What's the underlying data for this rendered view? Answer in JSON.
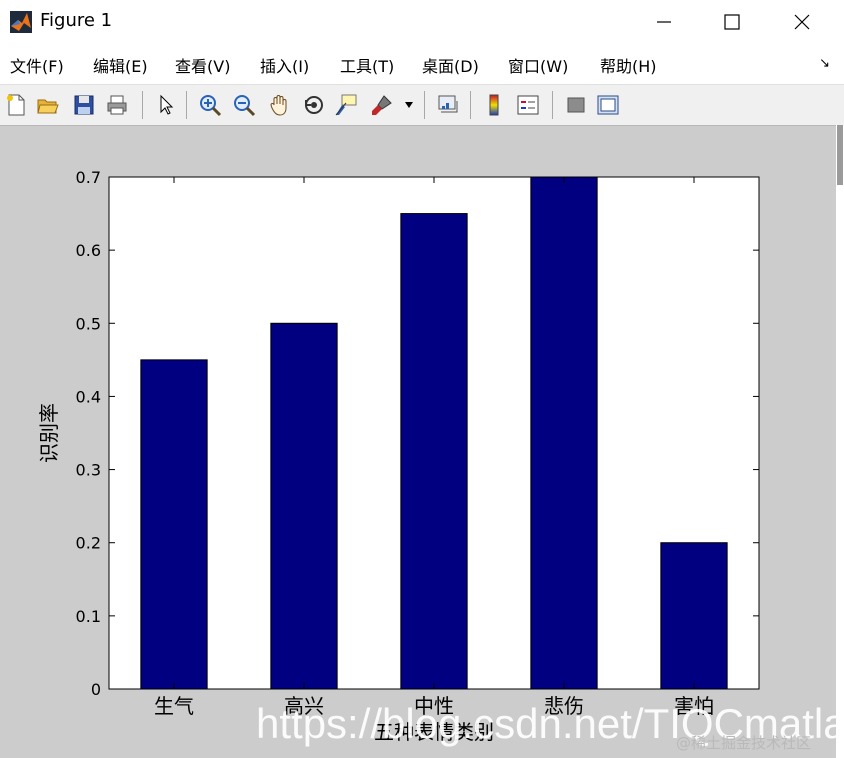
{
  "window": {
    "title": "Figure 1",
    "minimize_glyph": "—",
    "maximize_glyph": "☐",
    "close_glyph": "✕"
  },
  "menu": {
    "items": [
      "文件(F)",
      "编辑(E)",
      "查看(V)",
      "插入(I)",
      "工具(T)",
      "桌面(D)",
      "窗口(W)",
      "帮助(H)"
    ],
    "dock_arrow": "↘"
  },
  "toolbar": {
    "icons": [
      "new-file-icon",
      "open-folder-icon",
      "save-icon",
      "print-icon",
      "pointer-icon",
      "zoom-in-icon",
      "zoom-out-icon",
      "pan-hand-icon",
      "rotate-3d-icon",
      "data-cursor-icon",
      "brush-icon",
      "link-plot-icon",
      "colorbar-icon",
      "legend-icon",
      "hide-plot-tools-icon",
      "show-plot-tools-icon"
    ]
  },
  "chart_data": {
    "type": "bar",
    "categories": [
      "生气",
      "高兴",
      "中性",
      "悲伤",
      "害怕"
    ],
    "values": [
      0.45,
      0.5,
      0.65,
      0.7,
      0.2
    ],
    "title": "",
    "xlabel": "五种表情类别",
    "ylabel": "识别率",
    "ylim": [
      0,
      0.7
    ],
    "yticks": [
      "0",
      "0.1",
      "0.2",
      "0.3",
      "0.4",
      "0.5",
      "0.6",
      "0.7"
    ],
    "grid": false,
    "bar_color": "#000080"
  },
  "watermark": {
    "url": "https://blog.csdn.net/TIQCmatlab",
    "site": "@稀土掘金技术社区"
  },
  "colors": {
    "figure_background": "#cccccc",
    "axes_background": "#ffffff",
    "bar_fill": "#000080"
  }
}
